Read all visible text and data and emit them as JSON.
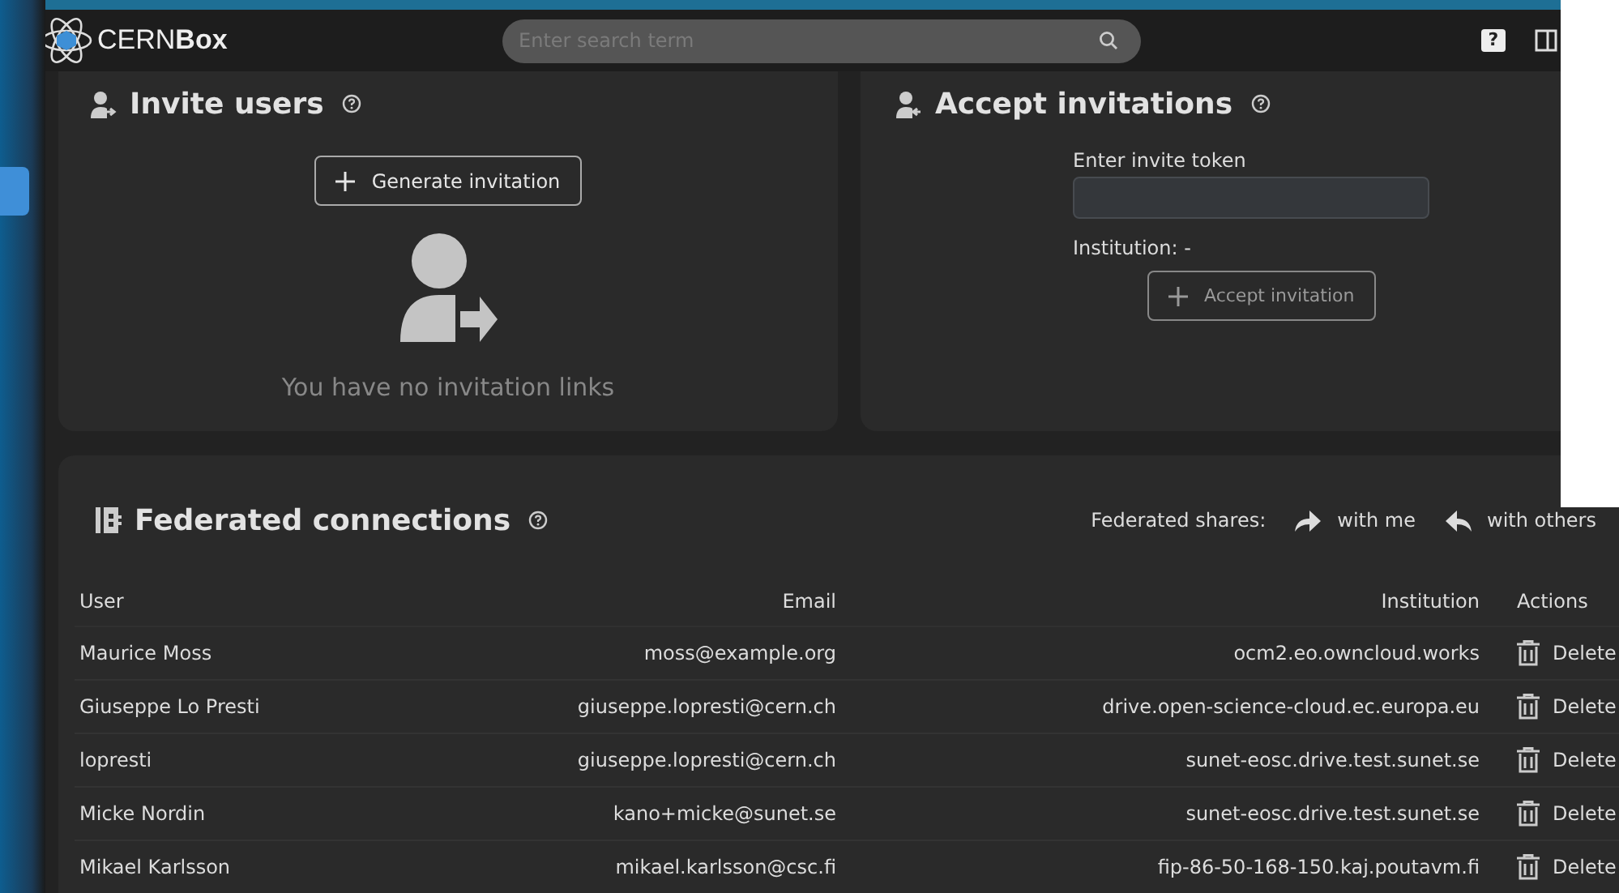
{
  "header": {
    "logo": "CERN**Box**",
    "search": {
      "placeholder": "Enter search term"
    },
    "help_button": "?"
  },
  "invite_users": {
    "title": "Invite users",
    "generate_button": "Generate invitation",
    "empty_text": "You have no invitation links"
  },
  "accept_invitations": {
    "title": "Accept invitations",
    "token_label": "Enter invite token",
    "institution": "Institution: -",
    "accept_button": "Accept invitation"
  },
  "federated_connections": {
    "title": "Federated connections",
    "shares_label": "Federated shares:",
    "shares_links": [
      {
        "label": "with me",
        "kind": "incoming"
      },
      {
        "label": "with others",
        "kind": "outgoing"
      }
    ],
    "table": {
      "columns": [
        "User",
        "Email",
        "Institution",
        "Actions"
      ],
      "rows": [
        {
          "user": "Maurice Moss",
          "email": "moss@example.org",
          "institution": "ocm2.eo.owncloud.works",
          "action": "Delete"
        },
        {
          "user": "Giuseppe Lo Presti",
          "email": "giuseppe.lopresti@cern.ch",
          "institution": "drive.open-science-cloud.ec.europa.eu",
          "action": "Delete"
        },
        {
          "user": "lopresti",
          "email": "giuseppe.lopresti@cern.ch",
          "institution": "sunet-eosc.drive.test.sunet.se",
          "action": "Delete"
        },
        {
          "user": "Micke Nordin",
          "email": "kano+micke@sunet.se",
          "institution": "sunet-eosc.drive.test.sunet.se",
          "action": "Delete"
        },
        {
          "user": "Mikael Karlsson",
          "email": "mikael.karlsson@csc.fi",
          "institution": "fip-86-50-168-150.kaj.poutavm.fi",
          "action": "Delete"
        }
      ]
    }
  }
}
